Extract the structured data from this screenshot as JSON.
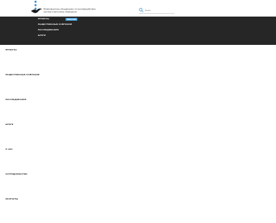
{
  "header": {
    "org_name": "Правозащитное объединение по противодействию пыткам и жестокому обращению",
    "search_placeholder": "Поиск"
  },
  "topmenu": {
    "items": [
      "Проекты",
      "Общественные кампании",
      "Расследования",
      "Блоги"
    ],
    "lang_badge": "ENGLISH"
  },
  "sidebar": {
    "items": [
      "Проекты",
      "Общественные кампании",
      "Расследования",
      "Блоги",
      "О нас",
      "Сотрудничество",
      "Контакты"
    ]
  }
}
